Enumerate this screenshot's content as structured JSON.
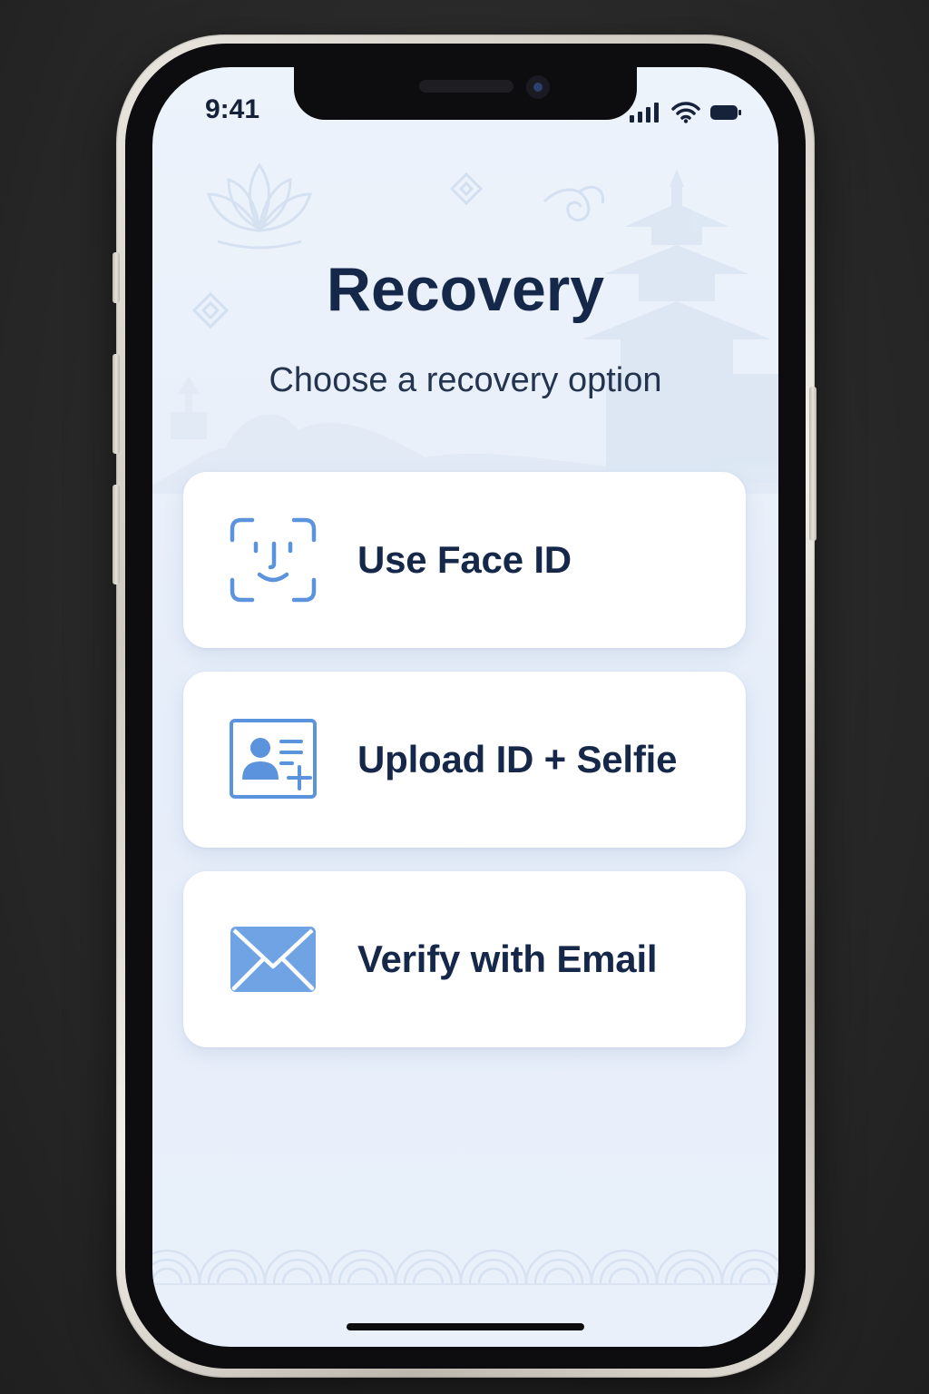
{
  "status_bar": {
    "time": "9:41",
    "icons": [
      "cellular-signal-icon",
      "wifi-icon",
      "battery-icon"
    ]
  },
  "header": {
    "title": "Recovery",
    "subtitle": "Choose a recovery option"
  },
  "options": [
    {
      "label": "Use Face ID",
      "icon": "face-id-icon"
    },
    {
      "label": "Upload ID + Selfie",
      "icon": "id-card-add-icon"
    },
    {
      "label": "Verify with Email",
      "icon": "envelope-icon"
    }
  ],
  "colors": {
    "accent": "#5b93dc",
    "text_primary": "#16284a",
    "background": "#e9f0fa",
    "card": "#ffffff"
  }
}
